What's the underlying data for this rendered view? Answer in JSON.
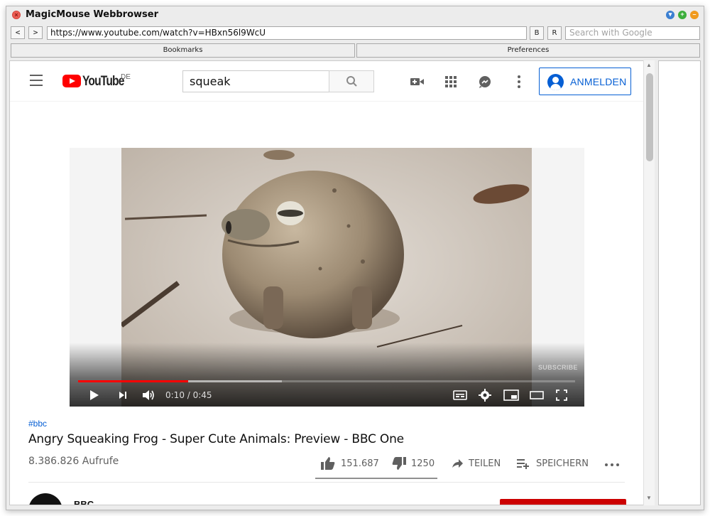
{
  "window": {
    "title": "MagicMouse Webbrowser"
  },
  "toolbar": {
    "back_label": "<",
    "forward_label": ">",
    "url": "https://www.youtube.com/watch?v=HBxn56l9WcU",
    "bookmark_btn": "B",
    "reload_btn": "R",
    "search_placeholder": "Search with Google",
    "bookmarks_label": "Bookmarks",
    "preferences_label": "Preferences"
  },
  "youtube": {
    "region": "DE",
    "search_query": "squeak",
    "signin_label": "ANMELDEN",
    "player": {
      "current_time": "0:10",
      "duration": "0:45",
      "time_display": "0:10 / 0:45",
      "watermark": "SUBSCRIBE",
      "played_fraction": 0.222,
      "buffered_fraction": 0.41
    },
    "video": {
      "hashtag": "#bbc",
      "title": "Angry Squeaking Frog - Super Cute Animals: Preview - BBC One",
      "views": "8.386.826 Aufrufe",
      "likes": "151.687",
      "dislikes": "1250",
      "share_label": "TEILEN",
      "save_label": "SPEICHERN",
      "channel_name": "BBC"
    }
  },
  "colors": {
    "yt_red": "#ff0000",
    "link_blue": "#065fd4"
  }
}
